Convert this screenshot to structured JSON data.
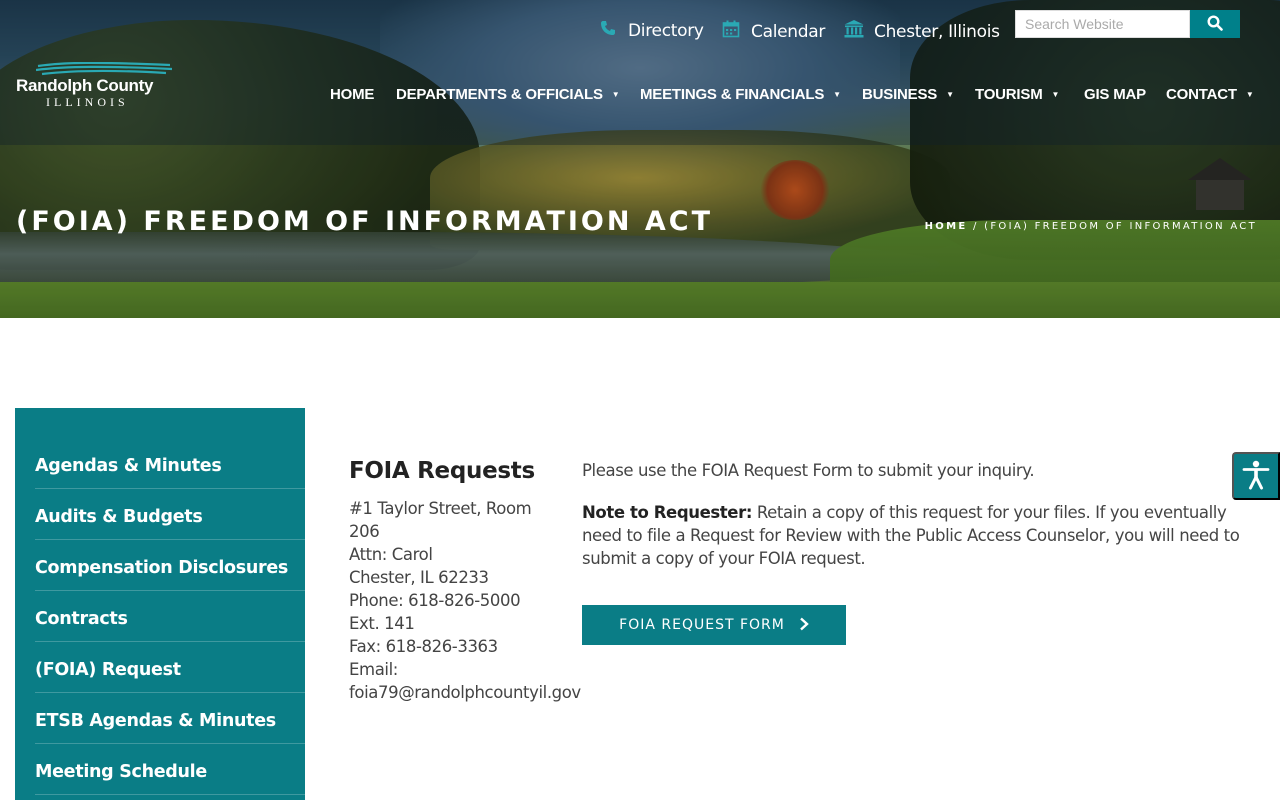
{
  "util": {
    "directory": "Directory",
    "calendar": "Calendar",
    "location": "Chester, Illinois",
    "search_placeholder": "Search Website"
  },
  "logo": {
    "name": "Randolph County",
    "state": "ILLINOIS"
  },
  "nav": {
    "home": "HOME",
    "departments": "DEPARTMENTS & OFFICIALS",
    "meetings": "MEETINGS & FINANCIALS",
    "business": "BUSINESS",
    "tourism": "TOURISM",
    "gis": "GIS MAP",
    "contact": "CONTACT"
  },
  "hero": {
    "title": "(FOIA) FREEDOM OF INFORMATION ACT",
    "breadcrumb_home": "HOME",
    "breadcrumb_sep": " / ",
    "breadcrumb_current": "(FOIA) FREEDOM OF INFORMATION ACT"
  },
  "sidebar": {
    "items": [
      {
        "label": "Agendas & Minutes"
      },
      {
        "label": "Audits & Budgets"
      },
      {
        "label": "Compensation Disclosures"
      },
      {
        "label": "Contracts"
      },
      {
        "label": "(FOIA) Request"
      },
      {
        "label": "ETSB Agendas & Minutes"
      },
      {
        "label": "Meeting Schedule"
      }
    ]
  },
  "content": {
    "title": "FOIA Requests",
    "address": "#1 Taylor Street, Room 206",
    "attn": "Attn: Carol",
    "city": "Chester, IL 62233",
    "phone": "Phone: 618-826-5000",
    "ext": "Ext. 141",
    "fax": "Fax: 618-826-3363",
    "email_label": "Email:",
    "email": "foia79@randolphcountyil.gov",
    "intro": "Please use the FOIA Request Form to submit your inquiry.",
    "note_label": "Note to Requester:",
    "note_text": " Retain a copy of this request for your files. If you eventually need to file a Request for Review with the Public Access Counselor, you will need to submit a copy of your FOIA request.",
    "button": "FOIA REQUEST FORM"
  },
  "colors": {
    "teal": "#0a7d86",
    "icon_teal": "#2aa9b4"
  }
}
